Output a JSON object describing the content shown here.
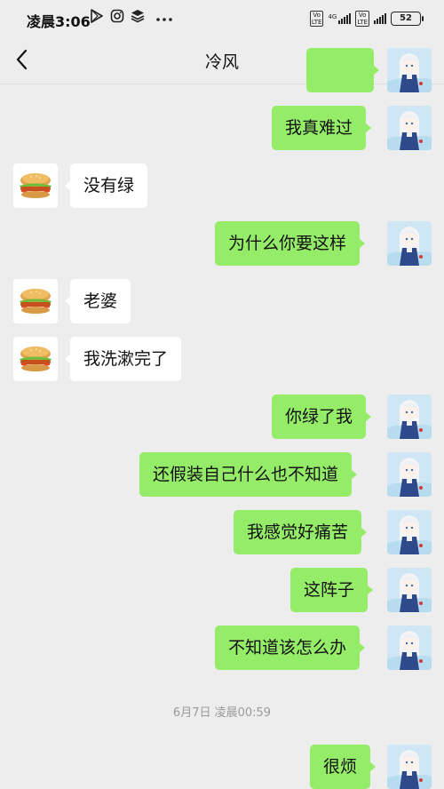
{
  "status_bar": {
    "time": "凌晨3:06",
    "network_tag_1": "Vo\nLTE",
    "network_tag_2": "4G",
    "network_tag_3": "Vo\nLTE",
    "battery": "52",
    "icons": [
      "play-store-icon",
      "instagram-icon",
      "layers-icon",
      "more-dots-icon"
    ]
  },
  "header": {
    "title": "冷风",
    "back_icon": "chevron-left-icon",
    "more_icon": "more-icon"
  },
  "messages": [
    {
      "side": "me",
      "text": ""
    },
    {
      "side": "me",
      "text": "我真难过"
    },
    {
      "side": "them",
      "text": "没有绿"
    },
    {
      "side": "me",
      "text": "为什么你要这样"
    },
    {
      "side": "them",
      "text": "老婆"
    },
    {
      "side": "them",
      "text": "我洗漱完了"
    },
    {
      "side": "me",
      "text": "你绿了我"
    },
    {
      "side": "me",
      "text": "还假装自己什么也不知道"
    },
    {
      "side": "me",
      "text": "我感觉好痛苦"
    },
    {
      "side": "me",
      "text": "这阵子"
    },
    {
      "side": "me",
      "text": "不知道该怎么办"
    },
    {
      "side": "me",
      "text": "很烦"
    }
  ],
  "timestamp": "6月7日 凌晨00:59",
  "colors": {
    "background": "#ededed",
    "my_bubble": "#95ec69",
    "their_bubble": "#ffffff"
  }
}
